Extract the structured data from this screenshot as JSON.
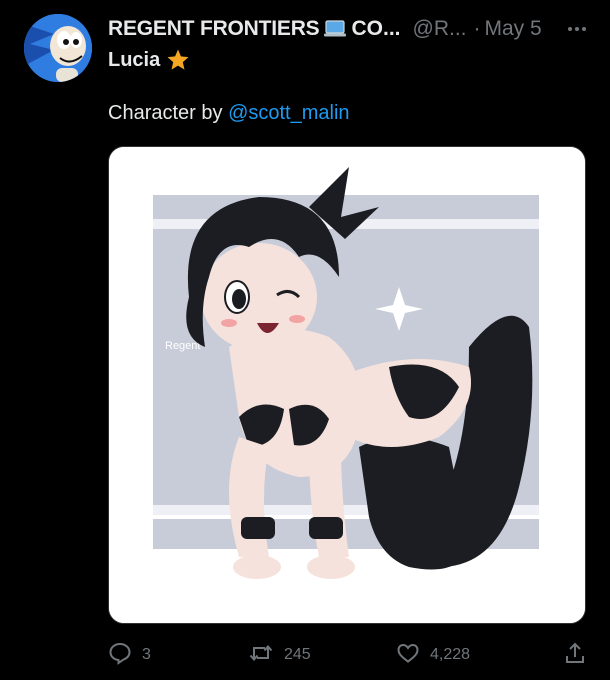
{
  "tweet": {
    "display_name": "REGENT FRONTIERS",
    "display_name_tail": "CO...",
    "handle": "@R...",
    "separator": "·",
    "date": "May 5",
    "sub_name": "Lucia",
    "text_prefix": "Character by ",
    "mention": "@scott_malin",
    "watermark": "Regent"
  },
  "actions": {
    "replies": "3",
    "retweets": "245",
    "likes": "4,228"
  },
  "colors": {
    "background": "#000000",
    "text": "#e7e9ea",
    "muted": "#71767b",
    "link": "#1d9bf0",
    "star": "#f5a623"
  },
  "icons": {
    "laptop": "laptop-icon",
    "star": "star-icon",
    "more": "more-icon",
    "reply": "reply-icon",
    "retweet": "retweet-icon",
    "like": "heart-icon",
    "share": "share-icon"
  }
}
